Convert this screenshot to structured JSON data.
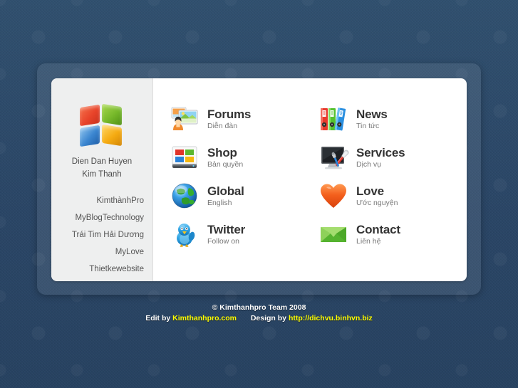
{
  "background": {
    "color": "#2d4b6d",
    "watermark": "windows-flag-pattern"
  },
  "card": {
    "background": "#ffffff",
    "sidebar_background": "#eeefef"
  },
  "sidebar": {
    "logo_icon": "windows-flag-icon",
    "brand_line1": "Dien Dan Huyen",
    "brand_line2": "Kim Thanh",
    "links": [
      {
        "label": "KimthànhPro"
      },
      {
        "label": "MyBlogTechnology"
      },
      {
        "label": "Trái Tim Hải Dương"
      },
      {
        "label": "MyLove"
      },
      {
        "label": "Thietkewebsite"
      }
    ]
  },
  "menu": {
    "items": [
      {
        "title": "Forums",
        "subtitle": "Diễn đàn",
        "icon": "forums-picture-icon"
      },
      {
        "title": "News",
        "subtitle": "Tin tức",
        "icon": "news-binders-icon"
      },
      {
        "title": "Shop",
        "subtitle": "Bản quyền",
        "icon": "shop-drive-icon"
      },
      {
        "title": "Services",
        "subtitle": "Dịch vụ",
        "icon": "services-monitor-tools-icon"
      },
      {
        "title": "Global",
        "subtitle": "English",
        "icon": "global-globe-icon"
      },
      {
        "title": "Love",
        "subtitle": "Ước nguyện",
        "icon": "love-heart-icon"
      },
      {
        "title": "Twitter",
        "subtitle": "Follow on",
        "icon": "twitter-bird-icon"
      },
      {
        "title": "Contact",
        "subtitle": "Liên hệ",
        "icon": "contact-envelope-icon"
      }
    ]
  },
  "footer": {
    "copyright": "© Kimthanhpro Team 2008",
    "edit_by_label": "Edit by",
    "edit_by_link": "Kimthanhpro.com",
    "design_by_label": "Design by",
    "design_by_link": "http://dichvu.binhvn.biz",
    "link_color": "#ffff00",
    "text_color": "#ffffff"
  }
}
